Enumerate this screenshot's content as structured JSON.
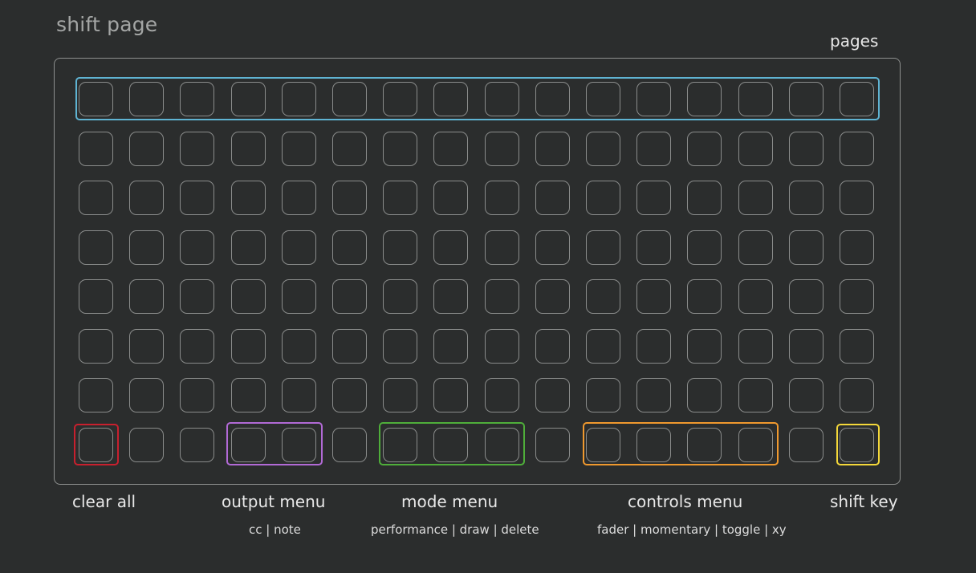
{
  "title": "shift page",
  "pages_label": "pages",
  "grid": {
    "columns": 16,
    "rows": 8
  },
  "groups": {
    "clear_all": {
      "label": "clear all",
      "color": "#c8202e"
    },
    "output_menu": {
      "label": "output menu",
      "sub": "cc | note",
      "color": "#b26ad6"
    },
    "mode_menu": {
      "label": "mode menu",
      "sub": "performance  | draw | delete",
      "color": "#4fae3a"
    },
    "controls_menu": {
      "label": "controls menu",
      "sub": "fader  | momentary | toggle | xy",
      "color": "#f0992e"
    },
    "shift_key": {
      "label": "shift key",
      "color": "#f4d83a"
    },
    "pages": {
      "color": "#5fb3d2"
    }
  }
}
